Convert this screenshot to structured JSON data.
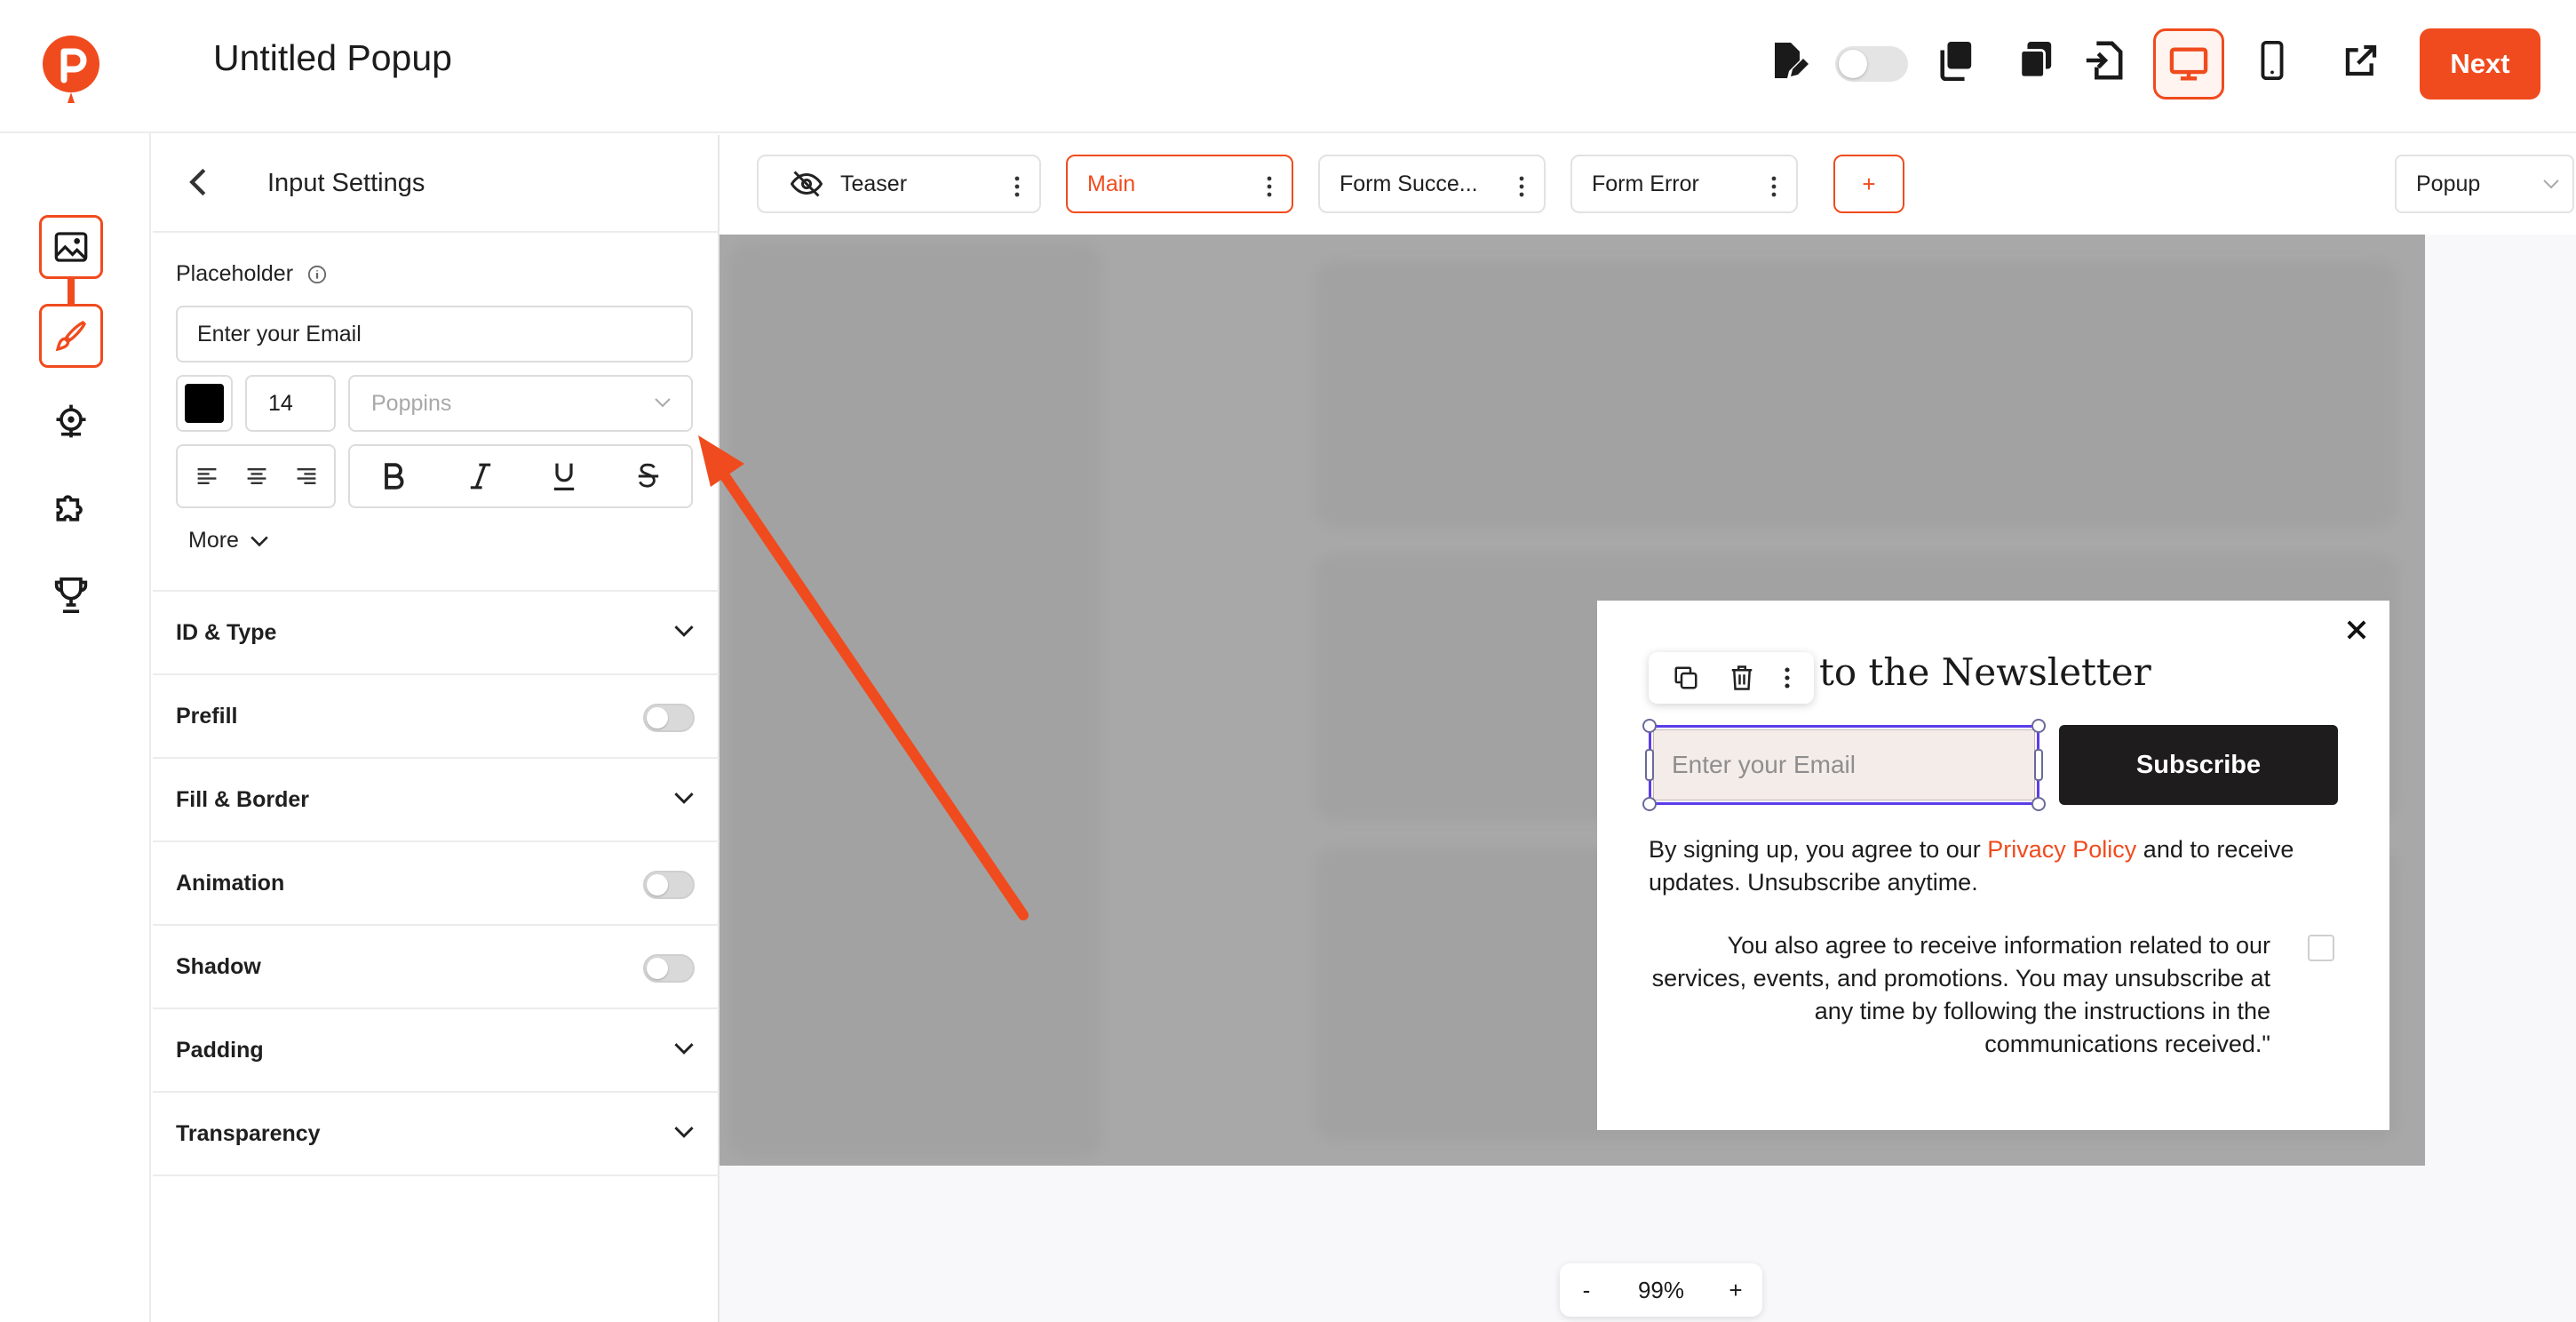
{
  "app": {
    "title": "Untitled Popup",
    "next_label": "Next",
    "accent_color": "#f04b1e",
    "toolbar_icons": [
      "edit-doc-icon",
      "toggle",
      "copy-icon",
      "duplicate-icon",
      "import-icon",
      "desktop-icon",
      "mobile-icon",
      "external-link-icon"
    ]
  },
  "rail": {
    "items": [
      "image-icon",
      "brush-icon",
      "target-icon",
      "puzzle-icon",
      "trophy-icon"
    ]
  },
  "panel": {
    "title": "Input Settings",
    "placeholder_label": "Placeholder",
    "placeholder_value": "Enter your Email",
    "text_color": "#000000",
    "font_size": "14",
    "font_family_placeholder": "Poppins",
    "more_label": "More",
    "sections": [
      {
        "label": "ID & Type",
        "control": "chevron"
      },
      {
        "label": "Prefill",
        "control": "toggle"
      },
      {
        "label": "Fill & Border",
        "control": "chevron"
      },
      {
        "label": "Animation",
        "control": "toggle"
      },
      {
        "label": "Shadow",
        "control": "toggle"
      },
      {
        "label": "Padding",
        "control": "chevron"
      },
      {
        "label": "Transparency",
        "control": "chevron"
      }
    ]
  },
  "tabs": [
    {
      "label": "Teaser",
      "active": false
    },
    {
      "label": "Main",
      "active": true
    },
    {
      "label": "Form Succe...",
      "active": false
    },
    {
      "label": "Form Error",
      "active": false
    }
  ],
  "add_tab_label": "+",
  "display_type": "Popup",
  "popup": {
    "heading": "to the Newsletter",
    "email_placeholder": "Enter your Email",
    "subscribe_label": "Subscribe",
    "consent_prefix": "By signing up, you agree to our ",
    "consent_link": "Privacy Policy",
    "consent_suffix": " and to receive updates. Unsubscribe anytime.",
    "extra_consent": "You also agree to receive information related to our services, events, and promotions. You may unsubscribe at any time by following the instructions in the communications received.\""
  },
  "zoom": {
    "minus": "-",
    "value": "99%",
    "plus": "+"
  }
}
